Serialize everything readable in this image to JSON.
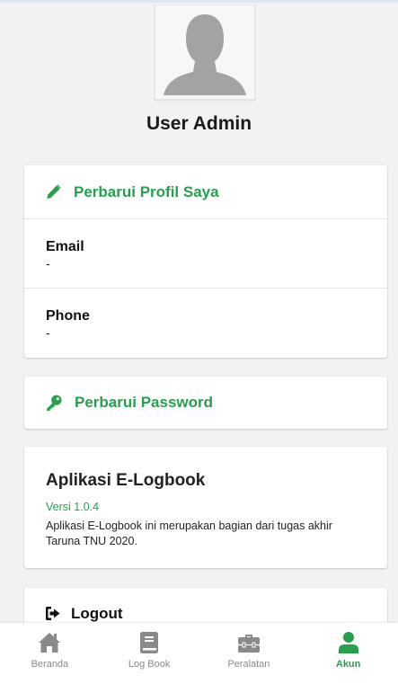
{
  "profile": {
    "name": "User Admin",
    "avatar_icon": "user-silhouette-icon"
  },
  "actions": {
    "update_profile": {
      "label": "Perbarui Profil Saya",
      "icon": "pencil-icon"
    },
    "update_password": {
      "label": "Perbarui Password",
      "icon": "key-icon"
    },
    "logout": {
      "label": "Logout",
      "icon": "sign-out-icon"
    }
  },
  "fields": {
    "email": {
      "label": "Email",
      "value": "-"
    },
    "phone": {
      "label": "Phone",
      "value": "-"
    }
  },
  "about": {
    "title": "Aplikasi E-Logbook",
    "version": "Versi 1.0.4",
    "description": "Aplikasi E-Logbook ini merupakan bagian dari tugas akhir Taruna TNU 2020."
  },
  "nav": {
    "items": [
      {
        "label": "Beranda",
        "icon": "home-icon",
        "active": false
      },
      {
        "label": "Log Book",
        "icon": "book-icon",
        "active": false
      },
      {
        "label": "Peralatan",
        "icon": "toolbox-icon",
        "active": false
      },
      {
        "label": "Akun",
        "icon": "user-icon",
        "active": true
      }
    ]
  },
  "colors": {
    "accent": "#27a04e",
    "inactive": "#8a8a8a",
    "background": "#f2f2f2"
  }
}
